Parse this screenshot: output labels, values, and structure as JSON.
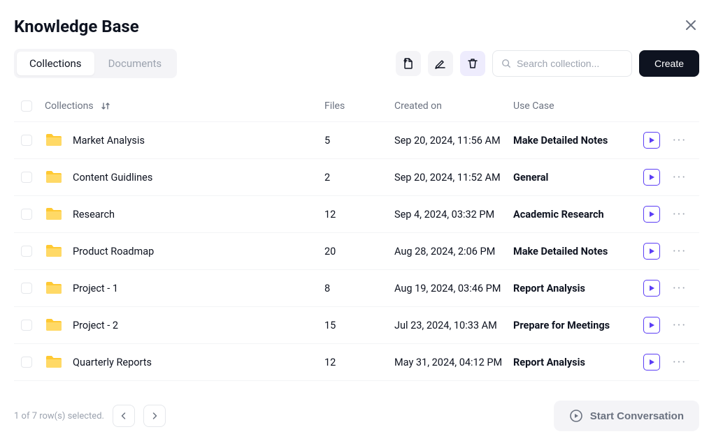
{
  "page_title": "Knowledge Base",
  "tabs": {
    "collections": "Collections",
    "documents": "Documents"
  },
  "search": {
    "placeholder": "Search collection..."
  },
  "buttons": {
    "create": "Create",
    "start_conversation": "Start Conversation"
  },
  "columns": {
    "collections": "Collections",
    "files": "Files",
    "created_on": "Created on",
    "use_case": "Use Case"
  },
  "rows": [
    {
      "name": "Market Analysis",
      "files": "5",
      "created_on": "Sep 20, 2024, 11:56 AM",
      "use_case": "Make Detailed Notes"
    },
    {
      "name": "Content Guidlines",
      "files": "2",
      "created_on": "Sep 20, 2024, 11:52 AM",
      "use_case": "General"
    },
    {
      "name": "Research",
      "files": "12",
      "created_on": "Sep 4, 2024, 03:32 PM",
      "use_case": "Academic Research"
    },
    {
      "name": "Product Roadmap",
      "files": "20",
      "created_on": "Aug 28, 2024, 2:06 PM",
      "use_case": "Make Detailed Notes"
    },
    {
      "name": "Project - 1",
      "files": "8",
      "created_on": "Aug 19, 2024, 03:46 PM",
      "use_case": "Report Analysis"
    },
    {
      "name": "Project - 2",
      "files": "15",
      "created_on": "Jul 23, 2024, 10:33 AM",
      "use_case": "Prepare for Meetings"
    },
    {
      "name": "Quarterly Reports",
      "files": "12",
      "created_on": "May 31, 2024, 04:12 PM",
      "use_case": "Report Analysis"
    }
  ],
  "pagination": {
    "status": "1 of 7 row(s) selected."
  }
}
